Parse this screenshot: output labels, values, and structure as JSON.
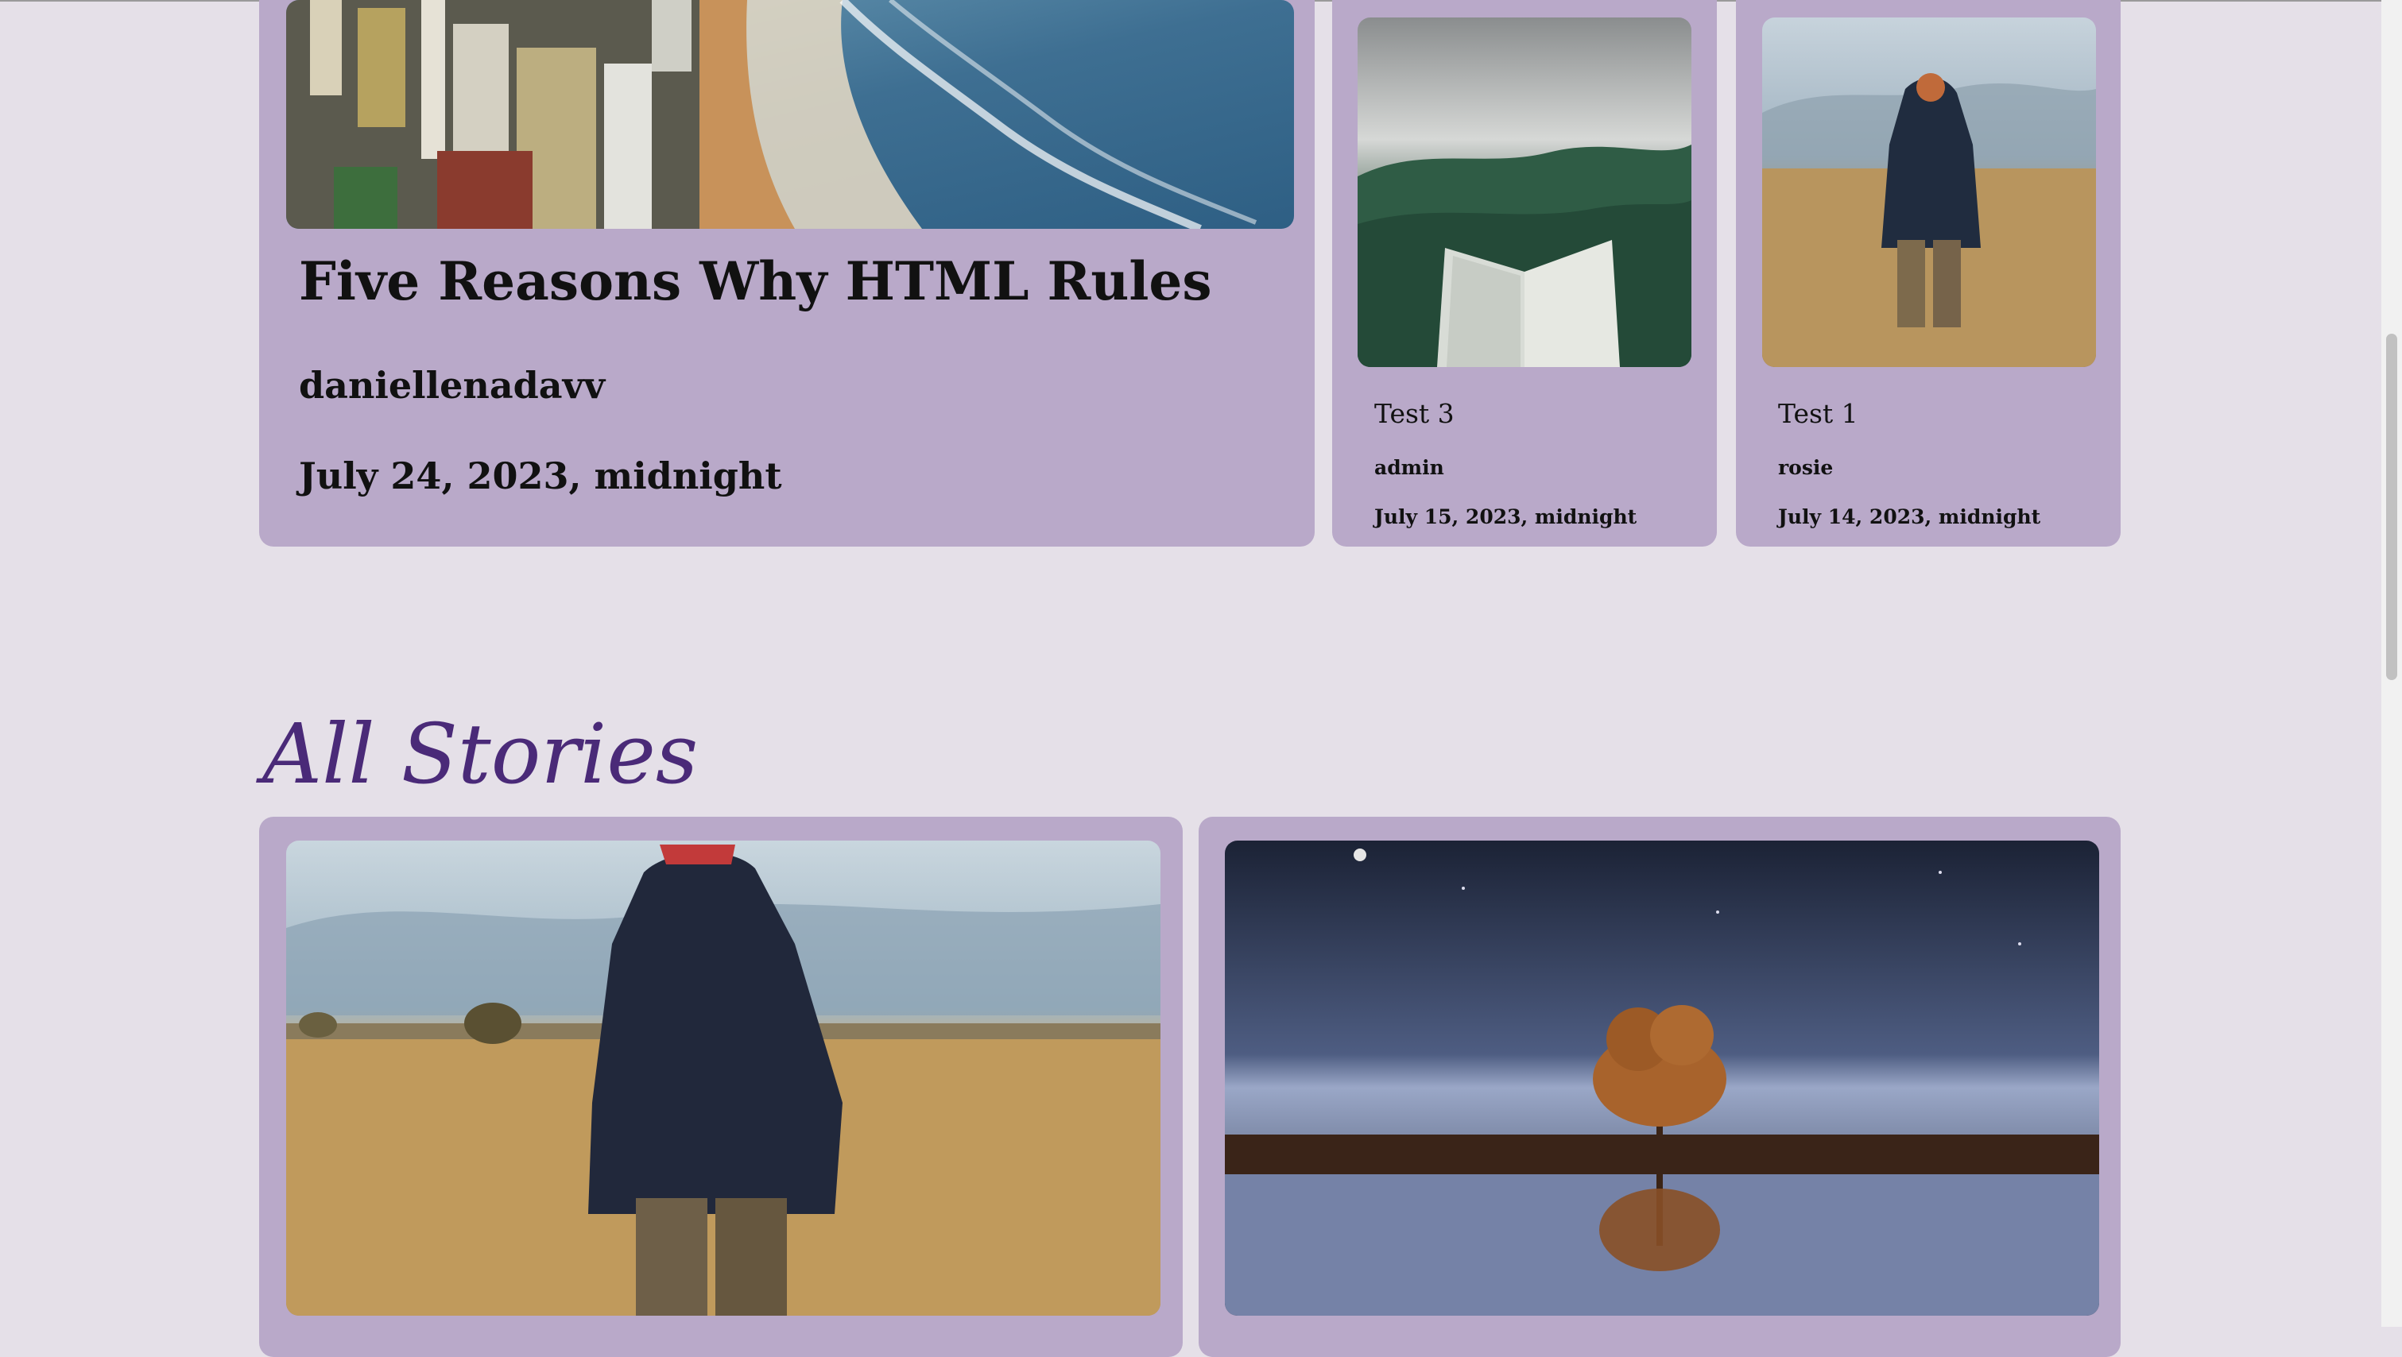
{
  "featured": {
    "title": "Five Reasons Why HTML Rules",
    "author": "daniellenadavv",
    "date": "July 24, 2023, midnight"
  },
  "side_stories": [
    {
      "title": "Test 3",
      "author": "admin",
      "date": "July 15, 2023, midnight"
    },
    {
      "title": "Test 1",
      "author": "rosie",
      "date": "July 14, 2023, midnight"
    }
  ],
  "all_stories": {
    "heading": "All Stories"
  },
  "colors": {
    "page_background": "#e5e0e8",
    "card_background": "#b9a9c9",
    "heading_accent": "#4a2a78"
  }
}
